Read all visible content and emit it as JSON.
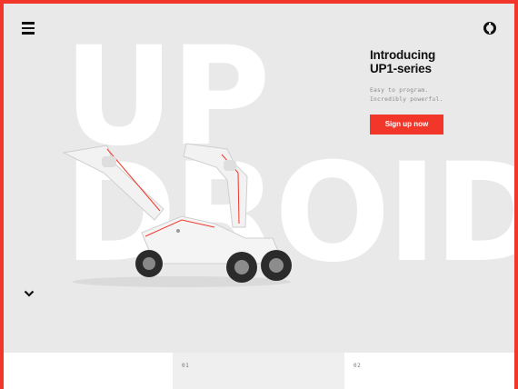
{
  "hero": {
    "wordmark_line1": "UP",
    "wordmark_line2": "DROID",
    "headline_line1": "Introducing",
    "headline_line2": "UP1-series",
    "tagline_line1": "Easy to program.",
    "tagline_line2": "Incredibly powerful.",
    "cta_label": "Sign up now"
  },
  "nav": {
    "menu_icon": "hamburger-menu-icon",
    "logo_icon": "circle-logo-icon",
    "scroll_icon": "chevron-down-icon"
  },
  "panels": [
    {
      "number": ""
    },
    {
      "number": "01"
    },
    {
      "number": "02"
    }
  ],
  "colors": {
    "accent": "#f2372a",
    "hero_background": "#e8e9e8",
    "wordmark": "#ffffff",
    "text": "#111111"
  }
}
